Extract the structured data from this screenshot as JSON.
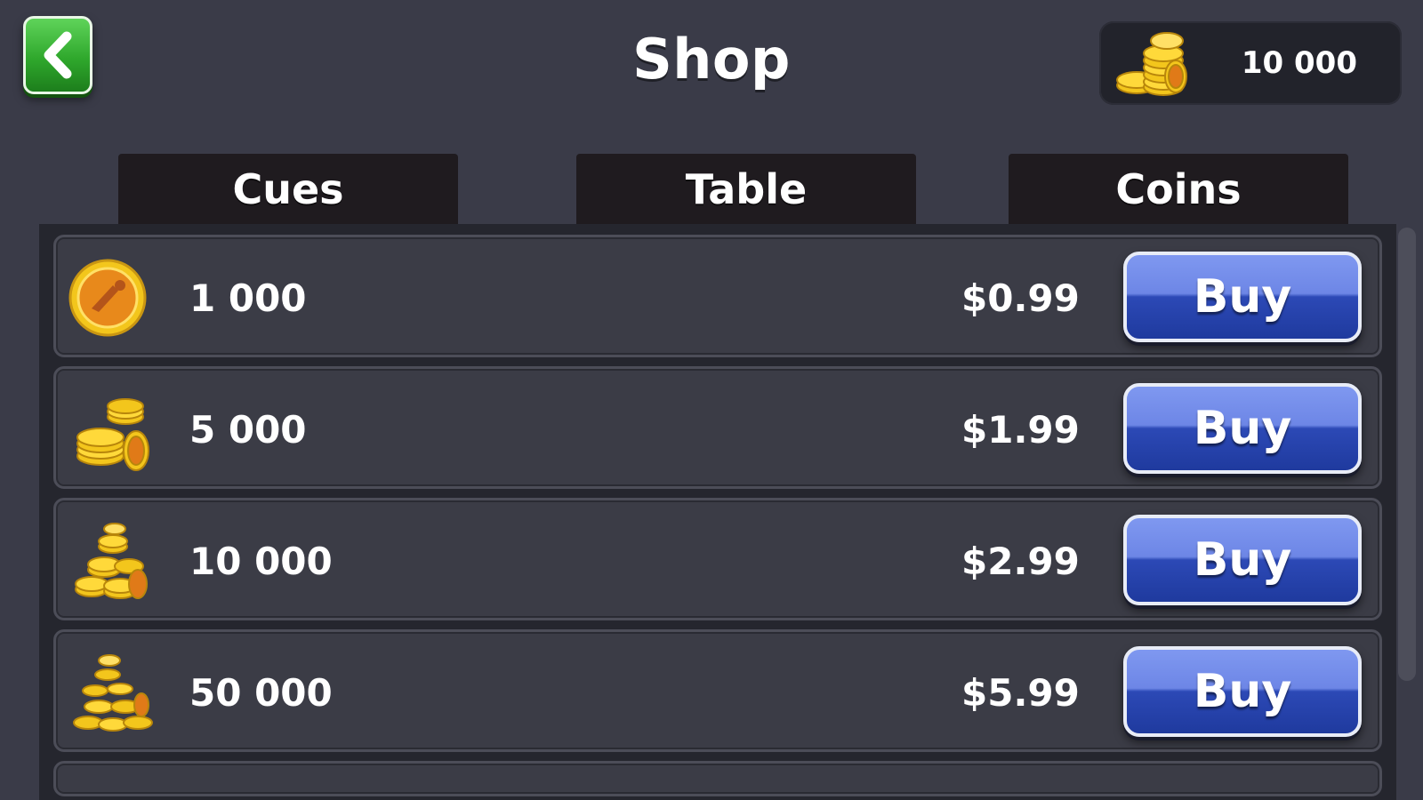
{
  "header": {
    "title": "Shop",
    "back_icon": "chevron-left-icon",
    "balance": {
      "icon": "coin-stack-icon",
      "amount": "10 000"
    }
  },
  "tabs": [
    {
      "label": "Cues"
    },
    {
      "label": "Table"
    },
    {
      "label": "Coins"
    }
  ],
  "colors": {
    "background": "#3a3b48",
    "panel": "#25262e",
    "row": "#3b3c46",
    "tab": "#1f1b1f",
    "buy_button": "#2c49b6",
    "back_button": "#2fa82c",
    "coin": "#f3c61c"
  },
  "products": [
    {
      "icon": "single-coin-icon",
      "amount": "1 000",
      "price": "$0.99",
      "button_label": "Buy"
    },
    {
      "icon": "coin-stack-small-icon",
      "amount": "5 000",
      "price": "$1.99",
      "button_label": "Buy"
    },
    {
      "icon": "coin-pile-icon",
      "amount": "10 000",
      "price": "$2.99",
      "button_label": "Buy"
    },
    {
      "icon": "coin-heap-icon",
      "amount": "50 000",
      "price": "$5.99",
      "button_label": "Buy"
    }
  ]
}
